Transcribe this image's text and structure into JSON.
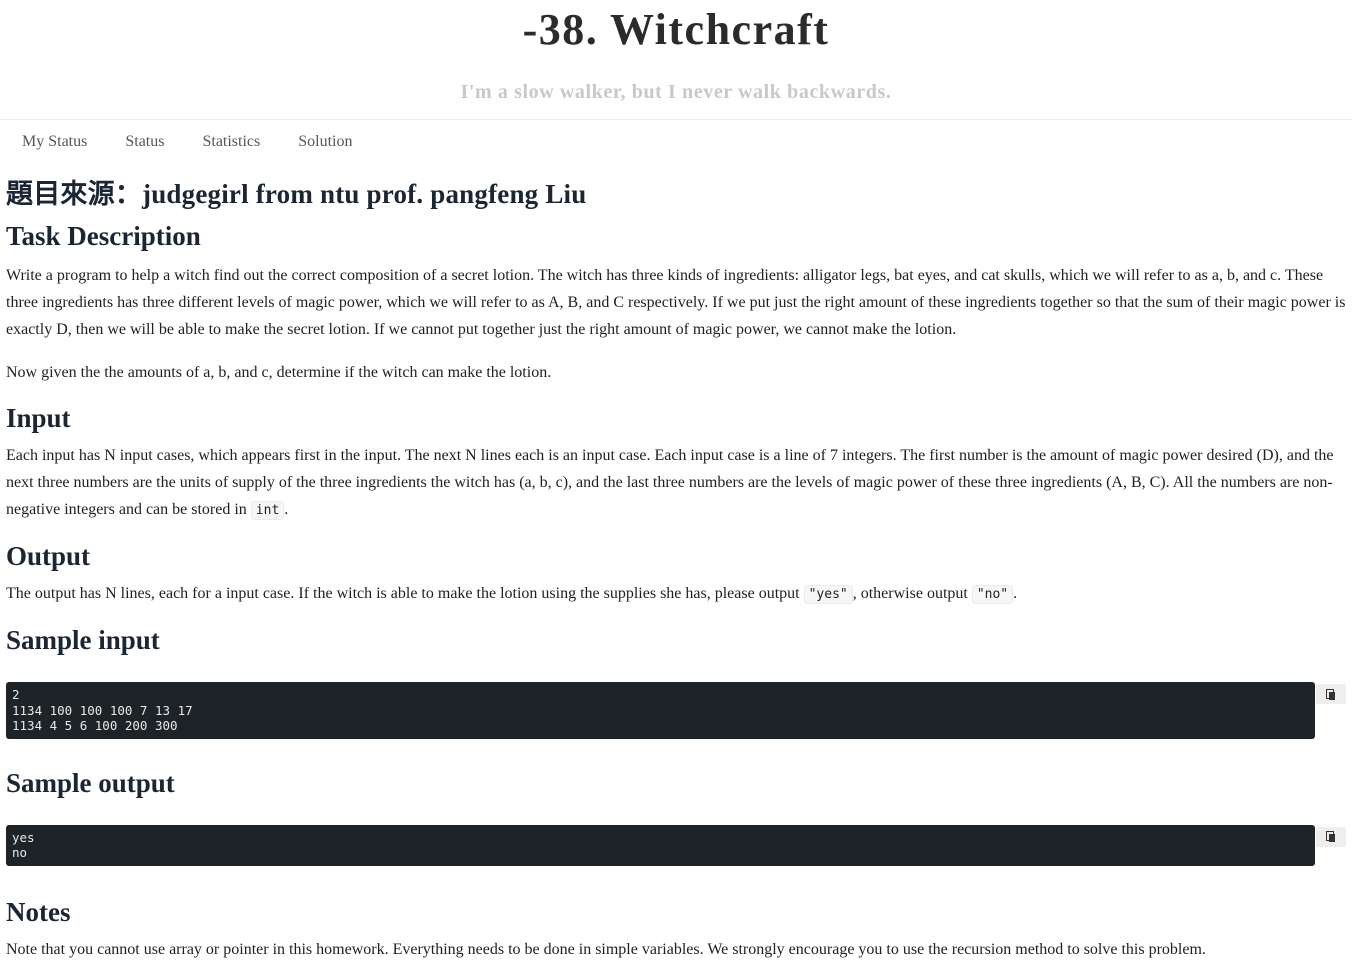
{
  "header": {
    "title": "-38. Witchcraft",
    "subtitle": "I'm a slow walker, but I never walk backwards."
  },
  "nav": {
    "items": [
      "My Status",
      "Status",
      "Statistics",
      "Solution"
    ]
  },
  "source_heading": "題目來源：judgegirl from ntu prof. pangfeng Liu",
  "task": {
    "heading": "Task Description",
    "p1_a": "Write a program to help a witch find out the correct composition of a secret lotion. The witch has three kinds of ingredients: alligator legs, bat eyes, and cat skulls, which we will refer to as ",
    "var_a": "a",
    "sep1": ", ",
    "var_b": "b",
    "sep2": ", and ",
    "var_c": "c",
    "p1_b": ". These three ingredients has three different levels of magic power, which we will refer to as ",
    "var_A": "A",
    "sep3": ", ",
    "var_B": "B",
    "sep4": ", and ",
    "var_C": "C",
    "p1_c": " respectively. If we put just the right amount of these ingredients together so that the sum of their magic power is exactly ",
    "var_D": "D",
    "p1_d": ", then we will be able to make the secret lotion. If we cannot put together just the right amount of magic power, we cannot make the lotion.",
    "p2_a": "Now given the the amounts of ",
    "p2_var_a": "a",
    "p2_sep1": ", ",
    "p2_var_b": "b",
    "p2_sep2": ", and ",
    "p2_var_c": "c",
    "p2_b": ", determine if the witch can make the lotion."
  },
  "input": {
    "heading": "Input",
    "t1": "Each input has ",
    "N1": "N",
    "t2": " input cases, which appears first in the input. The next ",
    "N2": "N",
    "t3": " lines each is an input case. Each input case is a line of ",
    "seven": "7",
    "t4": " integers. The first number is the amount of magic power desired ",
    "D": "(D)",
    "t5": ", and the next three numbers are the units of supply of the three ingredients the witch has ",
    "abc": "(a, b, c)",
    "t6": ", and the last three numbers are the levels of magic power of these three ingredients ",
    "ABC": "(A, B, C)",
    "t7": ". All the numbers are non-negative integers and can be stored in ",
    "int": "int",
    "t8": "."
  },
  "output": {
    "heading": "Output",
    "t1": "The output has ",
    "N": "N",
    "t2": " lines, each for a input case. If the witch is able to make the lotion using the supplies she has, please output ",
    "yes": "\"yes\"",
    "t3": ", otherwise output ",
    "no": "\"no\"",
    "t4": "."
  },
  "sample_input": {
    "heading": "Sample input",
    "code": "2\n1134 100 100 100 7 13 17\n1134 4 5 6 100 200 300"
  },
  "sample_output": {
    "heading": "Sample output",
    "code": "yes\nno"
  },
  "notes": {
    "heading": "Notes",
    "text": "Note that you cannot use array or pointer in this homework. Everything needs to be done in simple variables. We strongly encourage you to use the recursion method to solve this problem."
  }
}
